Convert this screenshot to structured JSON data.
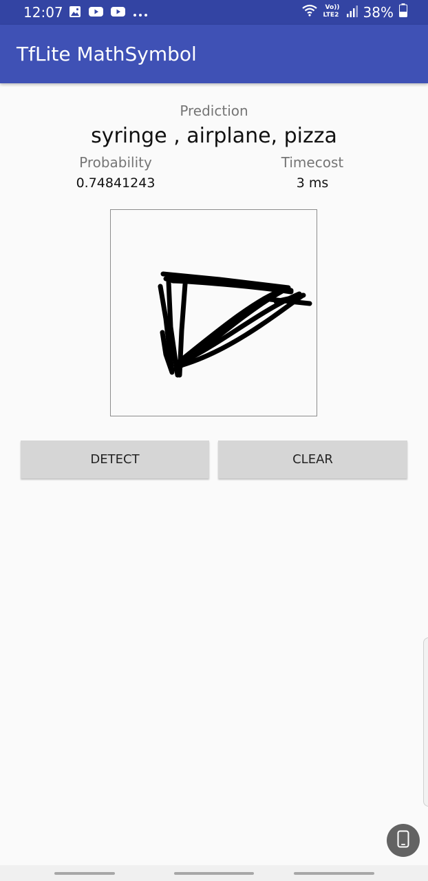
{
  "status_bar": {
    "time": "12:07",
    "left_icons": [
      "image-icon",
      "youtube-icon",
      "youtube-icon",
      "more-icon"
    ],
    "right_icons": [
      "wifi-icon",
      "volte-lte2-icon",
      "signal-icon",
      "battery-icon"
    ],
    "network_label_top": "Vo))",
    "network_label_bottom": "LTE2",
    "battery": "38%"
  },
  "app_bar": {
    "title": "TfLite MathSymbol",
    "color": "#3f51b5"
  },
  "prediction": {
    "label": "Prediction",
    "value": "syringe , airplane, pizza"
  },
  "probability": {
    "label": "Probability",
    "value": "0.74841243"
  },
  "timecost": {
    "label": "Timecost",
    "value": "3 ms"
  },
  "buttons": {
    "detect": "DETECT",
    "clear": "CLEAR"
  },
  "floating_button": {
    "icon": "phone-icon"
  },
  "colors": {
    "status_bar": "#3344a3",
    "app_bar": "#3f51b5",
    "button_bg": "#d6d6d6",
    "background": "#fafafa"
  }
}
